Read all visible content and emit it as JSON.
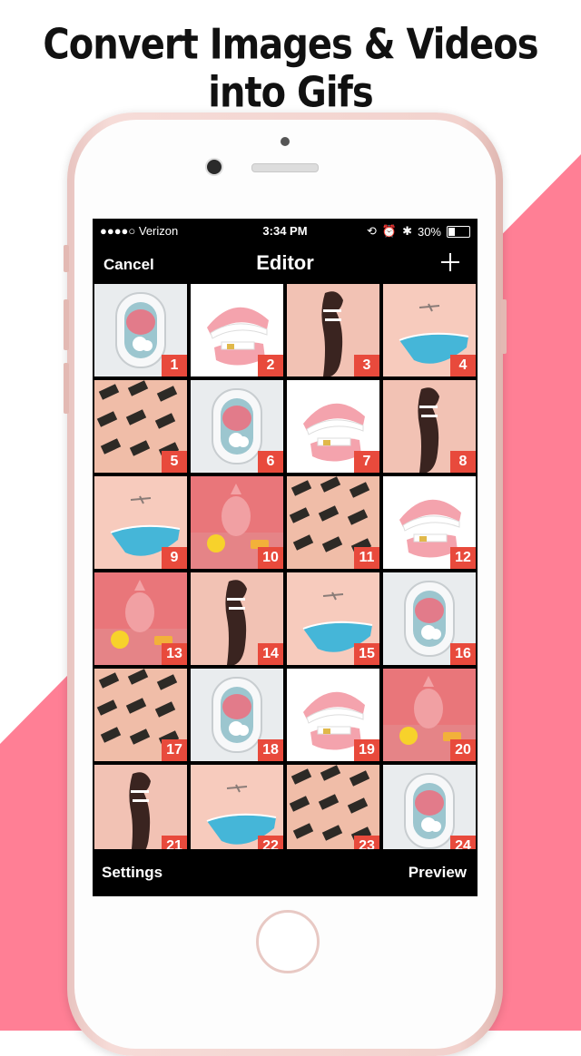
{
  "headline": "Convert Images & Videos into Gifs",
  "colors": {
    "accent_pink": "#ff7f95",
    "badge": "#e84a3c"
  },
  "status_bar": {
    "carrier": "●●●●○ Verizon",
    "time": "3:34 PM",
    "battery": "30%",
    "battery_level": 0.3
  },
  "nav": {
    "cancel": "Cancel",
    "title": "Editor",
    "add_icon": "plus-icon"
  },
  "tiles": [
    {
      "n": "1",
      "kind": "window"
    },
    {
      "n": "2",
      "kind": "teeth"
    },
    {
      "n": "3",
      "kind": "figure"
    },
    {
      "n": "4",
      "kind": "pool"
    },
    {
      "n": "5",
      "kind": "chairs"
    },
    {
      "n": "6",
      "kind": "window"
    },
    {
      "n": "7",
      "kind": "teeth"
    },
    {
      "n": "8",
      "kind": "figure"
    },
    {
      "n": "9",
      "kind": "pool"
    },
    {
      "n": "10",
      "kind": "pineapple"
    },
    {
      "n": "11",
      "kind": "chairs"
    },
    {
      "n": "12",
      "kind": "teeth"
    },
    {
      "n": "13",
      "kind": "pineapple"
    },
    {
      "n": "14",
      "kind": "figure"
    },
    {
      "n": "15",
      "kind": "pool"
    },
    {
      "n": "16",
      "kind": "window"
    },
    {
      "n": "17",
      "kind": "chairs"
    },
    {
      "n": "18",
      "kind": "window"
    },
    {
      "n": "19",
      "kind": "teeth"
    },
    {
      "n": "20",
      "kind": "pineapple"
    },
    {
      "n": "21",
      "kind": "figure"
    },
    {
      "n": "22",
      "kind": "pool"
    },
    {
      "n": "23",
      "kind": "chairs"
    },
    {
      "n": "24",
      "kind": "window"
    }
  ],
  "bottom": {
    "settings": "Settings",
    "preview": "Preview"
  }
}
